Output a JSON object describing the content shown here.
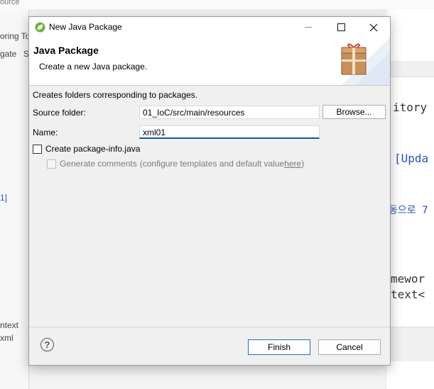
{
  "background": {
    "top_text": "ource",
    "left_texts": [
      "oring To",
      "gate",
      "S",
      "1]",
      "ntext",
      "xml"
    ],
    "right_code": [
      "itory",
      "[Upda",
      "동으로  7",
      "mewor",
      "text<"
    ]
  },
  "dialog": {
    "title": "New Java Package",
    "header_title": "Java Package",
    "header_desc": "Create a new Java package.",
    "info": "Creates folders corresponding to packages.",
    "source_folder_label": "Source folder:",
    "source_folder_value": "01_IoC/src/main/resources",
    "browse_label": "Browse...",
    "name_label": "Name:",
    "name_value": "xml01",
    "create_info_label": "Create package-info.java",
    "create_info_checked": false,
    "gen_comments_label": "Generate comments",
    "gen_comments_hint_prefix": "(configure templates and default value ",
    "gen_comments_link": "here",
    "gen_comments_hint_suffix": ")",
    "gen_comments_checked": false,
    "finish_label": "Finish",
    "cancel_label": "Cancel"
  }
}
